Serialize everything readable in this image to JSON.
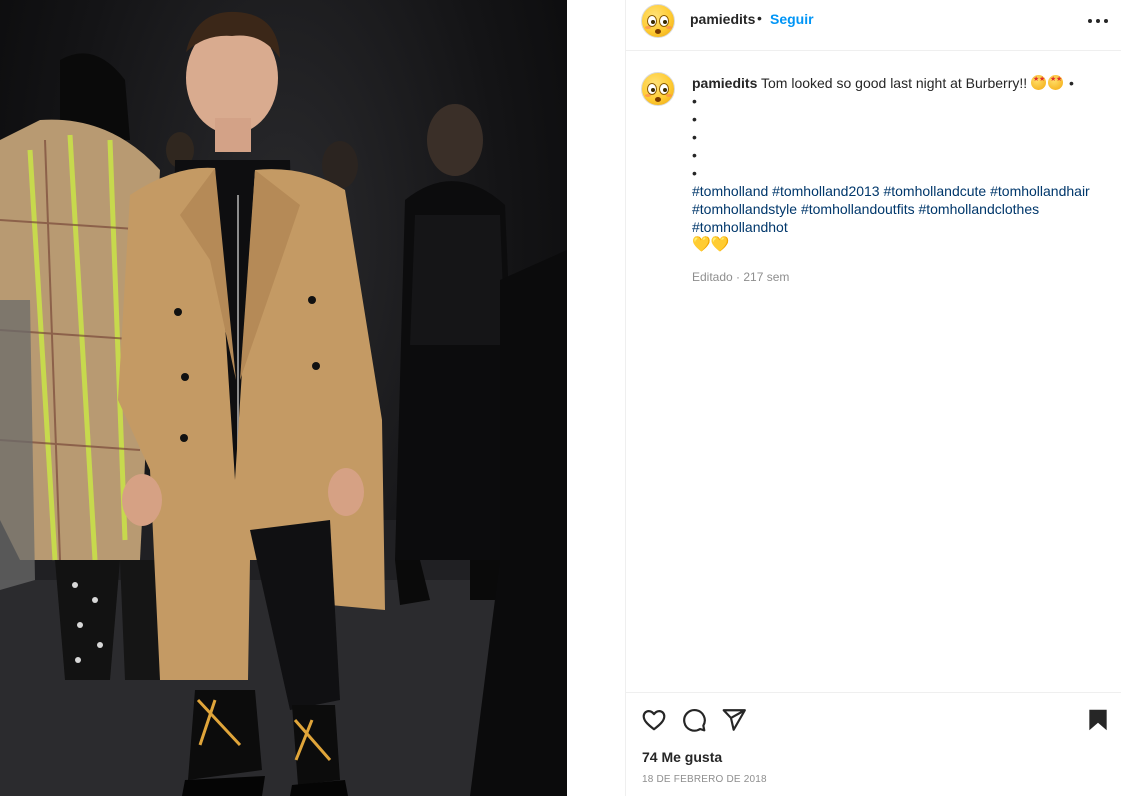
{
  "post": {
    "username": "pamiedits",
    "separator": "•",
    "follow_label": "Seguir",
    "more_icon": "more-options-icon",
    "caption": {
      "username": "pamiedits",
      "text": "Tom looked so good last night at Burberry!!",
      "emoji_pair": "star-struck-emoji",
      "bullet": "•",
      "bullets": [
        "•",
        "•",
        "•",
        "•",
        "•"
      ],
      "hashtags_line1": "#tomholland #tomholland2013 #tomhollandcute #tomhollandhair",
      "hashtags_line2": "#tomhollandstyle #tomhollandoutfits #tomhollandclothes",
      "hashtags_line3": "#tomhollandhot",
      "hearts": "💛💛"
    },
    "meta": "Editado · 217 sem",
    "likes": "74 Me gusta",
    "date": "18 DE FEBRERO DE 2018"
  },
  "icons": {
    "like": "heart-icon",
    "comment": "comment-icon",
    "share": "share-icon",
    "save": "bookmark-icon"
  },
  "colors": {
    "link_blue": "#0095f6",
    "hashtag": "#00376b",
    "muted": "#8e8e8e",
    "text": "#262626"
  }
}
